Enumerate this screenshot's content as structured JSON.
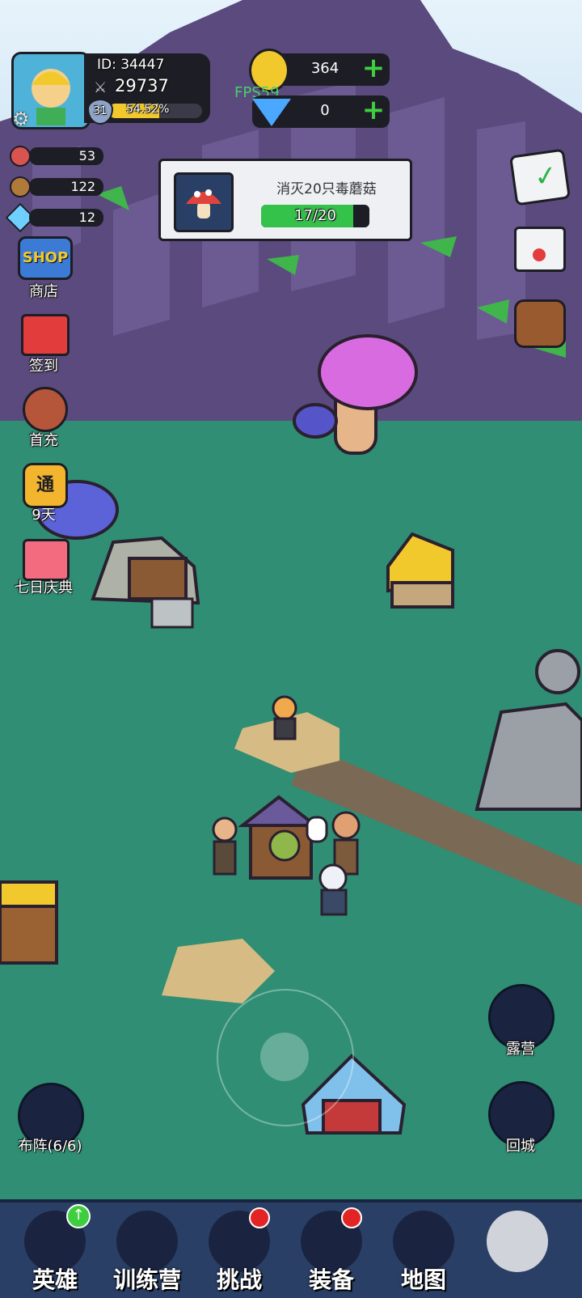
{
  "player": {
    "id_label": "ID: 34447",
    "power": "29737",
    "level": "31",
    "exp_percent": "54.52%",
    "exp_fill": 0.5452
  },
  "currency": {
    "gold": "364",
    "diamond": "0",
    "fps": "FPS59"
  },
  "resources": [
    {
      "icon": "meat-icon",
      "value": "53"
    },
    {
      "icon": "wood-icon",
      "value": "122"
    },
    {
      "icon": "crystal-icon",
      "value": "12"
    }
  ],
  "quest": {
    "title": "消灭20只毒蘑菇",
    "progress_text": "17/20",
    "progress_fill": 0.85
  },
  "left_menu": [
    {
      "label": "商店",
      "icon": "shop-icon",
      "badge": "SHOP"
    },
    {
      "label": "签到",
      "icon": "gift-icon"
    },
    {
      "label": "首充",
      "icon": "archer-girl-icon"
    },
    {
      "label": "9天",
      "icon": "pass-icon",
      "badge": "通"
    },
    {
      "label": "七日庆典",
      "icon": "celebration-gift-icon"
    }
  ],
  "right_menu": [
    {
      "icon": "task-list-icon"
    },
    {
      "icon": "mail-icon"
    },
    {
      "icon": "bag-icon"
    }
  ],
  "field_buttons": {
    "formation": "布阵(6/6)",
    "camp": "露营",
    "return_city": "回城"
  },
  "bottom_tabs": [
    {
      "label": "英雄",
      "icon": "heroes-icon",
      "badge": "up-arrow"
    },
    {
      "label": "训练营",
      "icon": "training-target-icon"
    },
    {
      "label": "挑战",
      "icon": "sword-shield-icon",
      "badge": "red-dot"
    },
    {
      "label": "装备",
      "icon": "armor-icon",
      "badge": "red-dot"
    },
    {
      "label": "地图",
      "icon": "map-icon"
    },
    {
      "label": "",
      "icon": "locked-icon"
    }
  ],
  "colors": {
    "ground": "#2f8e73",
    "cliff": "#5b4a7d",
    "exp_bar": "#f2c92d",
    "quest_bar": "#35c24b",
    "bottom_bar": "#2a3f66"
  }
}
